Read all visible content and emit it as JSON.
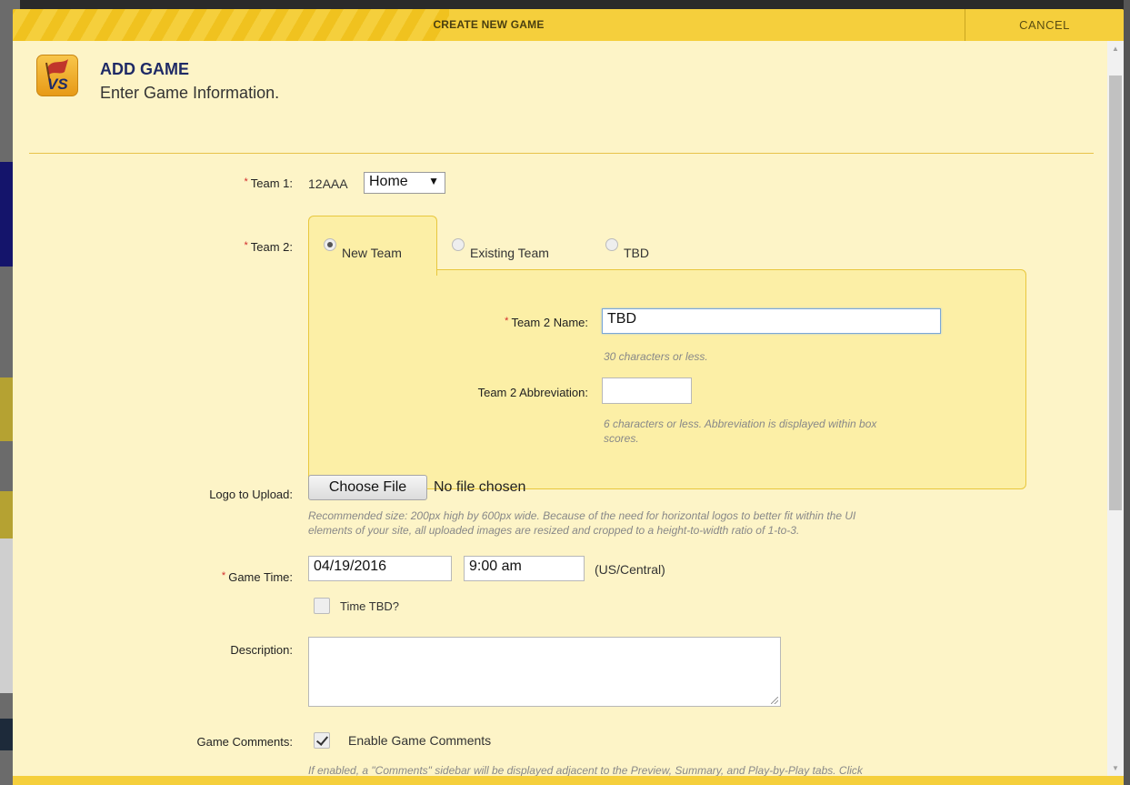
{
  "modal": {
    "title": "CREATE NEW GAME",
    "cancel_label": "CANCEL"
  },
  "header": {
    "icon_text": "VS",
    "title": "ADD GAME",
    "subtitle": "Enter Game Information."
  },
  "form": {
    "team1": {
      "label": "Team 1:",
      "value": "12AAA",
      "home_away": "Home"
    },
    "team2": {
      "label": "Team 2:",
      "tabs": [
        {
          "label": "New Team",
          "checked": true
        },
        {
          "label": "Existing Team",
          "checked": false
        },
        {
          "label": "TBD",
          "checked": false
        }
      ],
      "name_label": "Team 2 Name:",
      "name_value": "TBD",
      "name_help": "30 characters or less.",
      "abbr_label": "Team 2 Abbreviation:",
      "abbr_value": "",
      "abbr_help_line1": "6 characters or less. Abbreviation is displayed within box",
      "abbr_help_line2": "scores."
    },
    "logo": {
      "label": "Logo to Upload:",
      "button": "Choose File",
      "status": "No file chosen",
      "help_line1": "Recommended size: 200px high by 600px wide. Because of the need for horizontal logos to better fit within the UI",
      "help_line2": "elements of your site, all uploaded images are resized and cropped to a height-to-width ratio of 1-to-3."
    },
    "game_time": {
      "label": "Game Time:",
      "date": "04/19/2016",
      "time": "9:00 am",
      "timezone": "(US/Central)",
      "tbd_label": "Time TBD?",
      "tbd_checked": false
    },
    "description": {
      "label": "Description:",
      "value": ""
    },
    "comments": {
      "label": "Game Comments:",
      "checkbox_label": "Enable Game Comments",
      "checked": true,
      "help": "If enabled, a \"Comments\" sidebar will be displayed adjacent to the Preview, Summary, and Play-by-Play tabs. Click"
    }
  }
}
